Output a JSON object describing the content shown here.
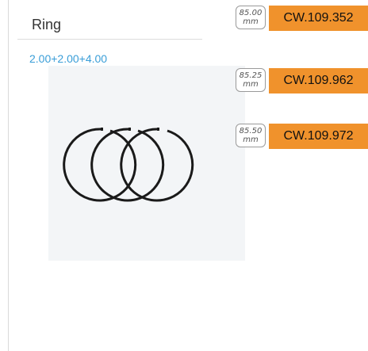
{
  "product": {
    "title": "Ring",
    "spec": "2.00+2.00+4.00",
    "image_icon": "piston-rings-set"
  },
  "variants": [
    {
      "size": "85.00",
      "unit": "mm",
      "code": "CW.109.352"
    },
    {
      "size": "85.25",
      "unit": "mm",
      "code": "CW.109.962"
    },
    {
      "size": "85.50",
      "unit": "mm",
      "code": "CW.109.972"
    }
  ],
  "colors": {
    "accent": "#f0922c",
    "spec_text": "#3a9ed8"
  }
}
